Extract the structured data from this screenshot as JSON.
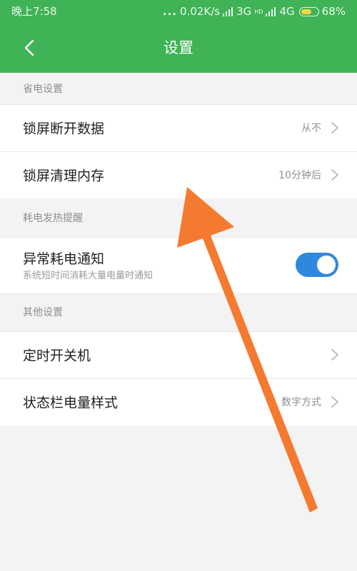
{
  "status_bar": {
    "time": "晚上7:58",
    "dots": "...",
    "network_speed": "0.02K/s",
    "network_3g": "3G",
    "network_hd": "HD",
    "network_4g": "4G",
    "battery_percent": "68%",
    "battery_level": 0.68
  },
  "header": {
    "title": "设置"
  },
  "sections": [
    {
      "title": "省电设置",
      "items": [
        {
          "label": "锁屏断开数据",
          "value": "从不"
        },
        {
          "label": "锁屏清理内存",
          "value": "10分钟后"
        }
      ]
    },
    {
      "title": "耗电发热提醒",
      "items": [
        {
          "label": "异常耗电通知",
          "subtitle": "系统短时间消耗大量电量时通知",
          "toggle_on": true
        }
      ]
    },
    {
      "title": "其他设置",
      "items": [
        {
          "label": "定时开关机",
          "value": ""
        },
        {
          "label": "状态栏电量样式",
          "value": "数字方式"
        }
      ]
    }
  ],
  "colors": {
    "header_green": "#3fb356",
    "toggle_blue": "#2f87de",
    "annotation_arrow_orange": "#f47a2f",
    "battery_yellow": "#f5d548"
  },
  "icons": {
    "back": "chevron-left-icon",
    "row_arrow": "chevron-right-icon",
    "signal": "signal-bars-icon",
    "battery": "battery-icon",
    "annotation": "orange-arrow-icon"
  }
}
